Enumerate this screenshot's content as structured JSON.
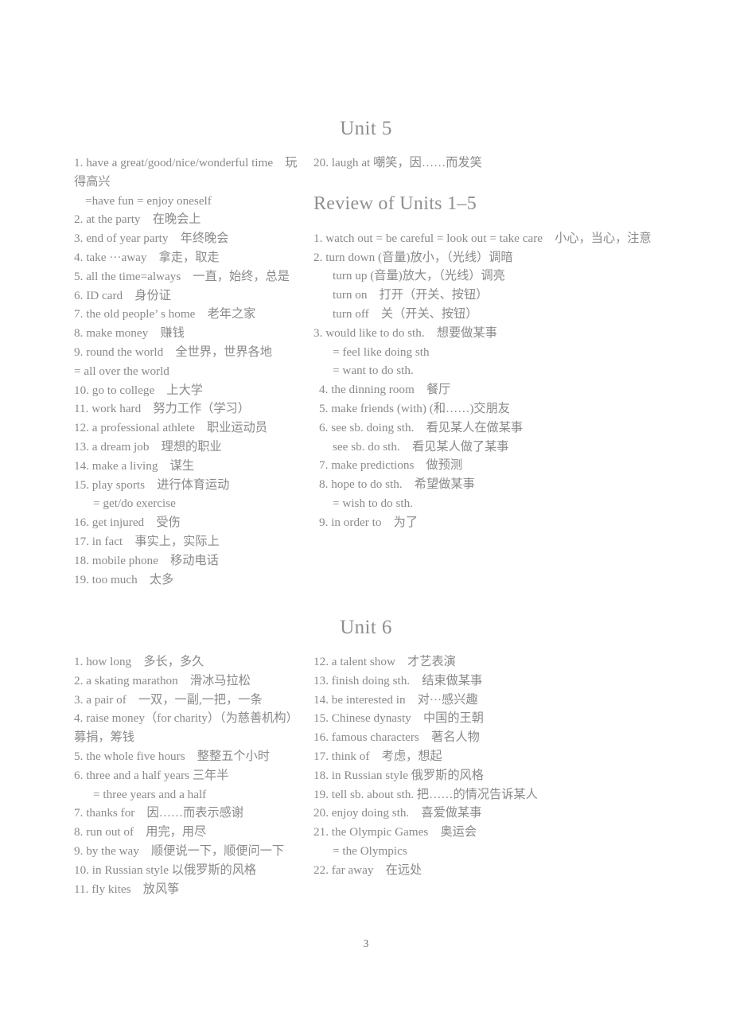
{
  "document": {
    "page_number": "3"
  },
  "unit5": {
    "heading": "Unit 5",
    "left_entries": [
      {
        "text": "1. have a great/good/nice/wonderful time　玩得高兴",
        "indent": "none"
      },
      {
        "text": "=have fun = enjoy oneself",
        "indent": "indent-1"
      },
      {
        "text": "2. at the party　在晚会上",
        "indent": "none"
      },
      {
        "text": "3. end of year party　年终晚会",
        "indent": "none"
      },
      {
        "text": "4. take ···away　拿走，取走",
        "indent": "none"
      },
      {
        "text": "5. all the time=always　一直，始终，总是",
        "indent": "none"
      },
      {
        "text": "6. ID card　身份证",
        "indent": "none"
      },
      {
        "text": "7. the old people’ s home　老年之家",
        "indent": "none"
      },
      {
        "text": "8. make money　赚钱",
        "indent": "none"
      },
      {
        "text": "9. round the world　全世界，世界各地",
        "indent": "none"
      },
      {
        "text": "= all over the world",
        "indent": "none"
      },
      {
        "text": "10. go to college　上大学",
        "indent": "none"
      },
      {
        "text": "11. work hard　努力工作（学习）",
        "indent": "none"
      },
      {
        "text": "12. a professional athlete　职业运动员",
        "indent": "none"
      },
      {
        "text": "13. a dream job　理想的职业",
        "indent": "none"
      },
      {
        "text": "14. make a living　谋生",
        "indent": "none"
      },
      {
        "text": "15. play sports　进行体育运动",
        "indent": "none"
      },
      {
        "text": "= get/do exercise",
        "indent": "indent-2"
      },
      {
        "text": "16. get injured　受伤",
        "indent": "none"
      },
      {
        "text": "17. in fact　事实上，实际上",
        "indent": "none"
      },
      {
        "text": "18. mobile phone　移动电话",
        "indent": "none"
      },
      {
        "text": "19. too much　太多",
        "indent": "none"
      }
    ],
    "right_entries": [
      {
        "text": "20. laugh at 嘲笑，因……而发笑",
        "indent": "none"
      }
    ]
  },
  "review": {
    "heading": "Review of Units 1–5",
    "entries": [
      {
        "text": "1. watch out = be careful = look out = take care　小心，当心，注意",
        "indent": "none"
      },
      {
        "text": "2. turn down (音量)放小，（光线）调暗",
        "indent": "none"
      },
      {
        "text": "turn up (音量)放大，（光线）调亮",
        "indent": "indent-2"
      },
      {
        "text": "turn on　打开（开关、按钮）",
        "indent": "indent-2"
      },
      {
        "text": "turn off　关（开关、按钮）",
        "indent": "indent-2"
      },
      {
        "text": "3. would like to do sth.　想要做某事",
        "indent": "none"
      },
      {
        "text": "= feel like doing sth",
        "indent": "indent-2"
      },
      {
        "text": "= want to do sth.",
        "indent": "indent-2"
      },
      {
        "text": "4. the dinning room　餐厅",
        "indent": "indent-half"
      },
      {
        "text": "5. make friends (with) (和……)交朋友",
        "indent": "indent-half"
      },
      {
        "text": "6. see sb. doing sth.　看见某人在做某事",
        "indent": "indent-half"
      },
      {
        "text": "see sb. do sth.　看见某人做了某事",
        "indent": "indent-2"
      },
      {
        "text": "7. make predictions　做预测",
        "indent": "indent-half"
      },
      {
        "text": "8. hope to do sth.　希望做某事",
        "indent": "indent-half"
      },
      {
        "text": "= wish to do sth.",
        "indent": "indent-2"
      },
      {
        "text": "9. in order to　为了",
        "indent": "indent-half"
      }
    ]
  },
  "unit6": {
    "heading": "Unit 6",
    "left_entries": [
      {
        "text": "1. how long　多长，多久",
        "indent": "none"
      },
      {
        "text": "2. a skating marathon　滑冰马拉松",
        "indent": "none"
      },
      {
        "text": "3. a pair of　一双，一副,一把，一条",
        "indent": "none"
      },
      {
        "text": "4. raise money（for charity）（为慈善机构）募捐，筹钱",
        "indent": "none"
      },
      {
        "text": "5. the whole five hours　整整五个小时",
        "indent": "none"
      },
      {
        "text": "6. three and a half years 三年半",
        "indent": "none"
      },
      {
        "text": "= three years and a half",
        "indent": "indent-2"
      },
      {
        "text": "7. thanks for　因……而表示感谢",
        "indent": "none"
      },
      {
        "text": "8. run out of　用完，用尽",
        "indent": "none"
      },
      {
        "text": "9. by the way　顺便说一下，顺便问一下",
        "indent": "none"
      },
      {
        "text": "10. in Russian style 以俄罗斯的风格",
        "indent": "none"
      },
      {
        "text": "11. fly kites　放风筝",
        "indent": "none"
      }
    ],
    "right_entries": [
      {
        "text": "12. a talent show　才艺表演",
        "indent": "none"
      },
      {
        "text": "13. finish doing sth.　结束做某事",
        "indent": "none"
      },
      {
        "text": "14. be interested in　对···感兴趣",
        "indent": "none"
      },
      {
        "text": "15. Chinese dynasty　中国的王朝",
        "indent": "none"
      },
      {
        "text": "16. famous characters　著名人物",
        "indent": "none"
      },
      {
        "text": "17. think of　考虑，想起",
        "indent": "none"
      },
      {
        "text": "18. in Russian style 俄罗斯的风格",
        "indent": "none"
      },
      {
        "text": "19. tell sb. about sth. 把……的情况告诉某人",
        "indent": "none"
      },
      {
        "text": "20. enjoy doing sth.　喜爱做某事",
        "indent": "none"
      },
      {
        "text": "21. the Olympic Games　奥运会",
        "indent": "none"
      },
      {
        "text": "= the Olympics",
        "indent": "indent-2"
      },
      {
        "text": "22. far away　在远处",
        "indent": "none"
      }
    ]
  }
}
